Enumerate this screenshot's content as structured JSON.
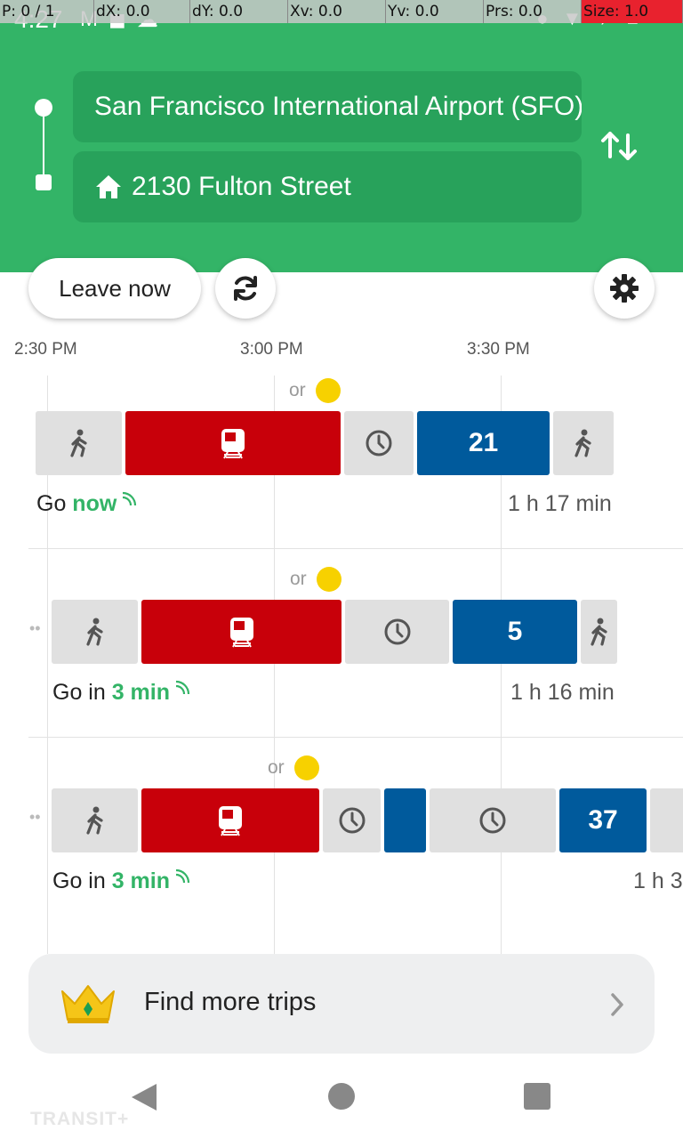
{
  "status_bar": {
    "time": "4:27",
    "left_icons": [
      "gmail-icon",
      "car-icon",
      "cloud-icon"
    ],
    "right_icons": [
      "location-icon",
      "wifi-icon",
      "airplane-icon",
      "battery-icon"
    ]
  },
  "debug_overlay": {
    "pointer": "P: 0 / 1",
    "dx": "dX: 0.0",
    "dy": "dY: 0.0",
    "xv": "Xv: 0.0",
    "yv": "Yv: 0.0",
    "prs": "Prs: 0.0",
    "size": "Size: 1.0"
  },
  "search": {
    "origin": "San Francisco International Airport (SFO)",
    "destination": "2130 Fulton Street",
    "destination_icon": "home-icon"
  },
  "controls": {
    "leave_label": "Leave now",
    "refresh_icon": "refresh-icon",
    "settings_icon": "gear-icon"
  },
  "timeline": {
    "labels": [
      "2:30 PM",
      "3:00 PM",
      "3:30 PM"
    ]
  },
  "trips": [
    {
      "or_label": "or",
      "go_prefix": "Go ",
      "go_value": "now",
      "duration": "1 h 17 min",
      "bus_route": "21"
    },
    {
      "or_label": "or",
      "go_prefix": "Go in ",
      "go_value": "3 min",
      "duration": "1 h 16 min",
      "bus_route": "5"
    },
    {
      "or_label": "or",
      "go_prefix": "Go in ",
      "go_value": "3 min",
      "duration": "1 h 3",
      "bus_route": "37"
    }
  ],
  "find_more": {
    "label": "Find more trips",
    "icon": "crown-icon"
  },
  "brand_watermark": "TRANSIT+",
  "colors": {
    "header_green": "#33b467",
    "field_green": "#28a25b",
    "rail_red": "#c8000a",
    "bus_blue": "#005a9c",
    "realtime_green": "#33b467",
    "or_dot_yellow": "#f7d100"
  }
}
